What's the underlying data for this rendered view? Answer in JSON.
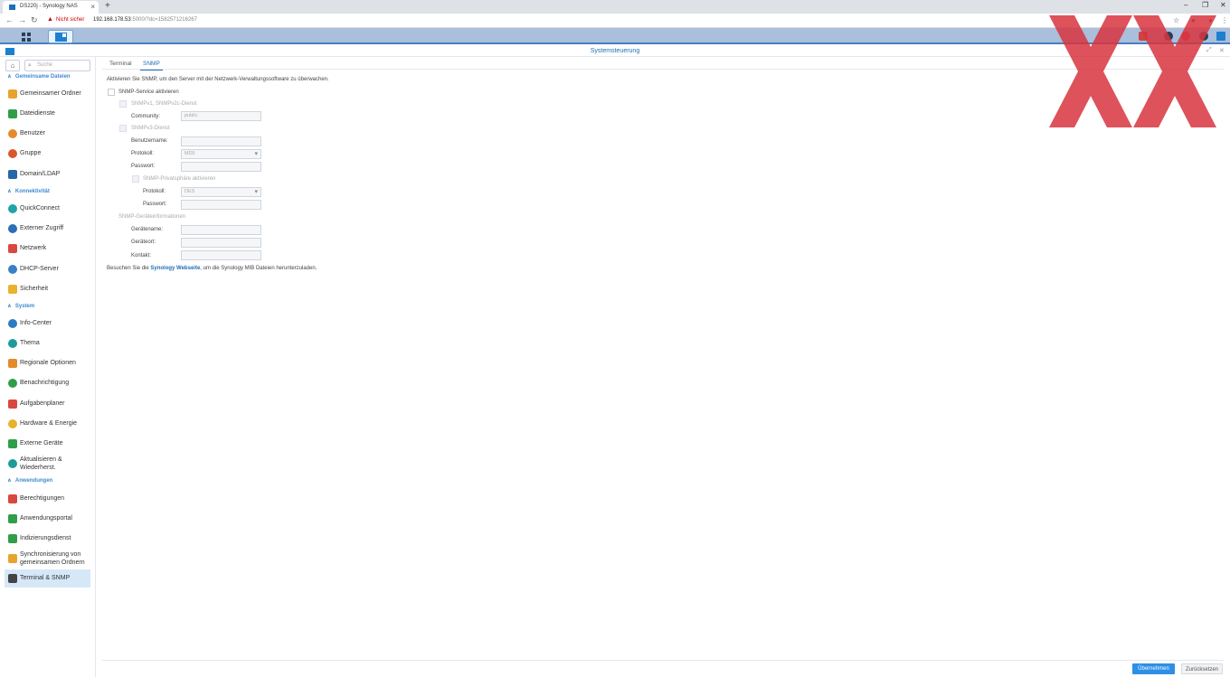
{
  "browser": {
    "tab_title": "DS220j - Synology NAS",
    "not_secure": "Nicht sicher",
    "url_main": "192.168.178.53",
    "url_rest": ":5000/?launchApp=SYNO.SDS.AdminCenter.Application",
    "url_display": ":5000/?dc=1582571216267"
  },
  "window": {
    "title": "Systemsteuerung"
  },
  "sidebar": {
    "search_placeholder": "Suche",
    "sections": {
      "shared": "Gemeinsame Dateien",
      "connectivity": "Konnektivität",
      "system": "System",
      "apps": "Anwendungen"
    },
    "items": {
      "shared_folder": "Gemeinsamer Ordner",
      "file_services": "Dateidienste",
      "user": "Benutzer",
      "group": "Gruppe",
      "domain": "Domain/LDAP",
      "quickconnect": "QuickConnect",
      "external_access": "Externer Zugriff",
      "network": "Netzwerk",
      "dhcp": "DHCP-Server",
      "security": "Sicherheit",
      "info": "Info-Center",
      "theme": "Thema",
      "regional": "Regionale Optionen",
      "notification": "Benachrichtigung",
      "task": "Aufgabenplaner",
      "hardware": "Hardware & Energie",
      "external_devices": "Externe Geräte",
      "update": "Aktualisieren & Wiederherst.",
      "privileges": "Berechtigungen",
      "portal": "Anwendungsportal",
      "indexing": "Indizierungsdienst",
      "sync": "Synchronisierung von gemeinsamen Ordnern",
      "terminal": "Terminal & SNMP"
    }
  },
  "tabs": {
    "terminal": "Terminal",
    "snmp": "SNMP"
  },
  "snmp": {
    "intro": "Aktivieren Sie SNMP, um den Server mit der Netzwerk-Verwaltungssoftware zu überwachen.",
    "enable": "SNMP-Service aktivieren",
    "v1v2": "SNMPv1, SNMPv2c-Dienst",
    "community_label": "Community:",
    "community_value": "public",
    "v3": "SNMPv3-Dienst",
    "username_label": "Benutzername:",
    "protocol_label": "Protokoll:",
    "protocol_value": "MD5",
    "password_label": "Passwort:",
    "privacy": "SNMP-Privatsphäre aktivieren",
    "privacy_protocol_label": "Protokoll:",
    "privacy_protocol_value": "DES",
    "privacy_password_label": "Passwort:",
    "device_info": "SNMP-Geräteinformationen",
    "device_name_label": "Gerätename:",
    "device_location_label": "Geräteort:",
    "contact_label": "Kontakt:",
    "footer_pre": "Besuchen Sie die ",
    "footer_link": "Synology Webseite",
    "footer_post": ", um die Synology MIB Dateien herunterzuladen."
  },
  "buttons": {
    "apply": "Übernehmen",
    "reset": "Zurücksetzen"
  },
  "colors": {
    "accent": "#1f6db5",
    "taskbar": "#a9bfdc",
    "apply": "#2d8fe6",
    "watermark": "#d9343f"
  }
}
